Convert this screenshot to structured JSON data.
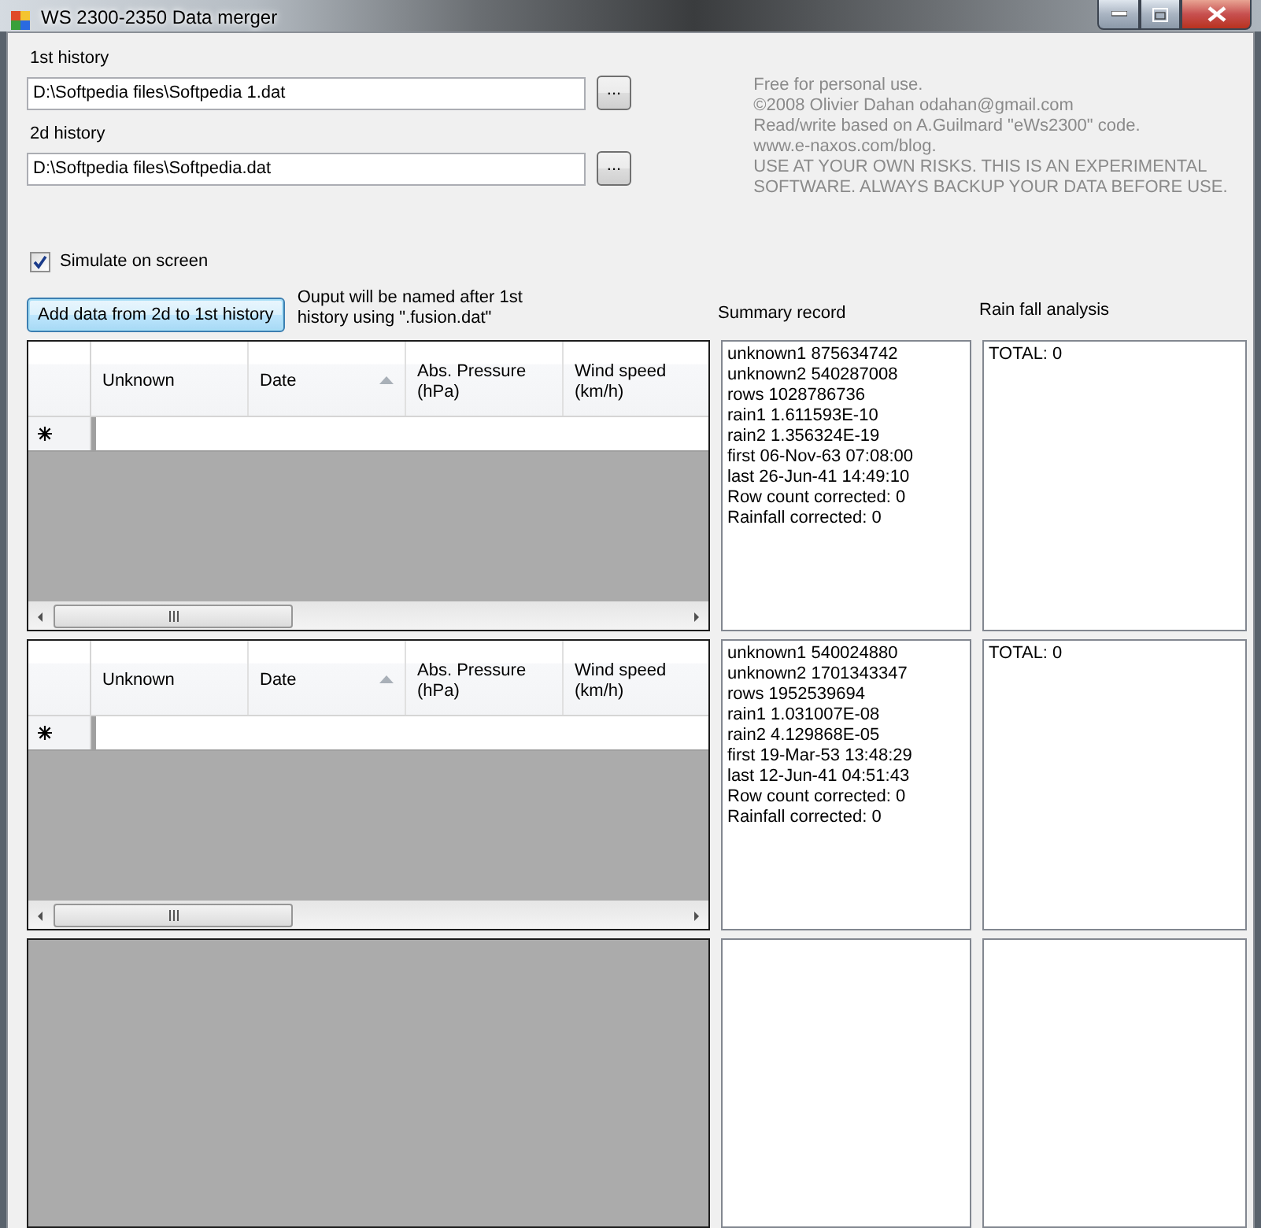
{
  "window": {
    "title": "WS 2300-2350 Data merger"
  },
  "history_fields": [
    {
      "label": "1st history",
      "value": "D:\\Softpedia files\\Softpedia 1.dat",
      "browse": "..."
    },
    {
      "label": "2d history",
      "value": "D:\\Softpedia files\\Softpedia.dat",
      "browse": "..."
    }
  ],
  "info": [
    "Free for personal use.",
    "©2008 Olivier Dahan odahan@gmail.com",
    "Read/write based on A.Guilmard \"eWs2300\" code.",
    "www.e-naxos.com/blog.",
    "USE AT YOUR OWN RISKS. THIS IS AN EXPERIMENTAL SOFTWARE. ALWAYS BACKUP YOUR DATA BEFORE USE."
  ],
  "simulate": {
    "label": "Simulate on screen",
    "checked": true
  },
  "merge_button": {
    "label": "Add data from 2d to 1st history",
    "focused": true
  },
  "output_note": "Ouput will be named after 1st history using \".fusion.dat\"",
  "summary_heading": "Summary record",
  "rain_heading": "Rain fall analysis",
  "sets": [
    {
      "grid": {
        "kind": "table",
        "columns": [
          {
            "label": "Unknown",
            "sorted": false
          },
          {
            "label": "Date",
            "sorted": true
          },
          {
            "label": "Abs. Pressure (hPa)",
            "sorted": false
          },
          {
            "label": "Wind speed (km/h)",
            "sorted": false
          }
        ],
        "new_row": true,
        "scrollbar": true
      },
      "summary": [
        "unknown1 875634742",
        "unknown2 540287008",
        "rows 1028786736",
        "rain1 1.611593E-10",
        "rain2 1.356324E-19",
        "first 06-Nov-63 07:08:00",
        "last 26-Jun-41 14:49:10",
        "Row count corrected: 0",
        "Rainfall corrected: 0"
      ],
      "rain": [
        "TOTAL: 0"
      ]
    },
    {
      "grid": {
        "kind": "table",
        "columns": [
          {
            "label": "Unknown",
            "sorted": false
          },
          {
            "label": "Date",
            "sorted": true
          },
          {
            "label": "Abs. Pressure (hPa)",
            "sorted": false
          },
          {
            "label": "Wind speed (km/h)",
            "sorted": false
          }
        ],
        "new_row": true,
        "scrollbar": true
      },
      "summary": [
        "unknown1 540024880",
        "unknown2 1701343347",
        "rows 1952539694",
        "rain1 1.031007E-08",
        "rain2 4.129868E-05",
        "first 19-Mar-53 13:48:29",
        "last 12-Jun-41 04:51:43",
        "Row count corrected: 0",
        "Rainfall corrected: 0"
      ],
      "rain": [
        "TOTAL: 0"
      ]
    },
    {
      "grid": {
        "kind": "empty"
      }
    }
  ]
}
